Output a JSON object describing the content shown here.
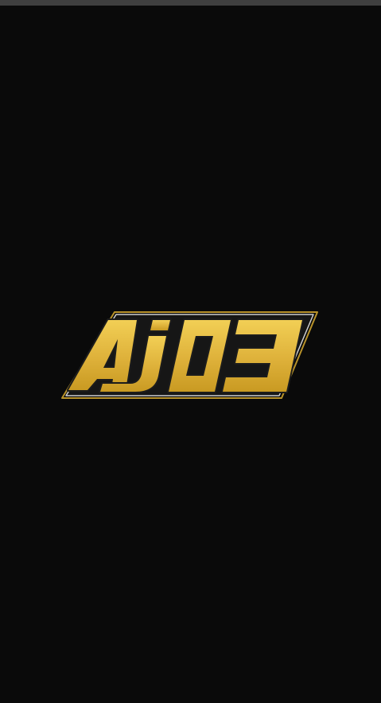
{
  "app": {
    "logo_text": "AJ03",
    "logo_icon": "aj03-logo-icon"
  },
  "colors": {
    "background": "#0a0a0a",
    "status_bar": "#3f3f3f",
    "logo_gold_light": "#f2cf55",
    "logo_gold_dark": "#c99a22",
    "logo_outline_dark": "#1c1c1c",
    "logo_outline_light": "#cfcfcf",
    "logo_outer_gold": "#b8922a"
  }
}
